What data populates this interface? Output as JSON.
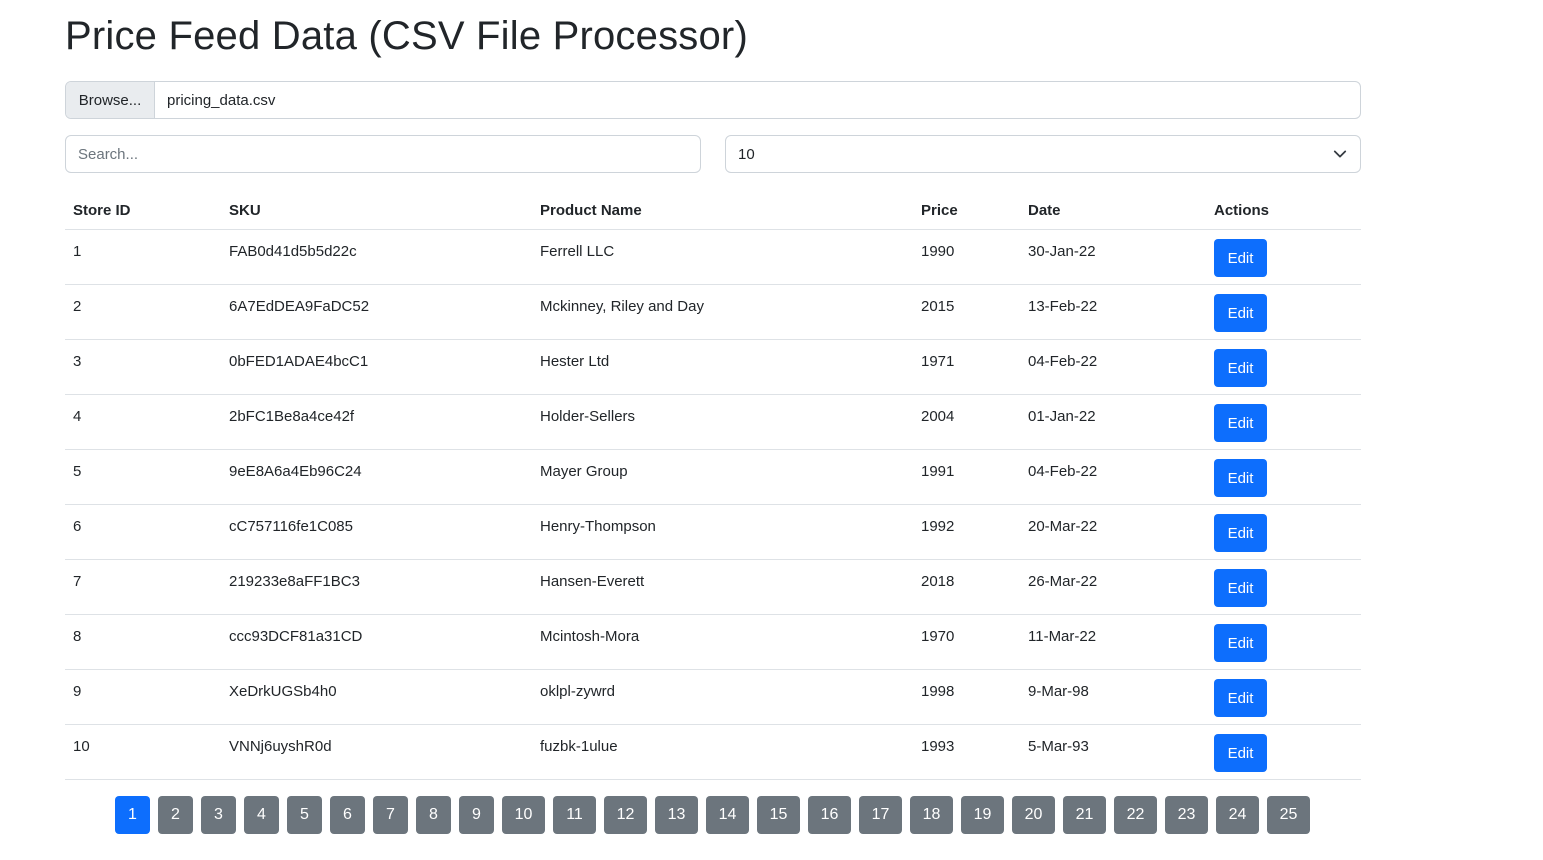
{
  "page_title": "Price Feed Data (CSV File Processor)",
  "file_input": {
    "button_label": "Browse...",
    "file_name": "pricing_data.csv"
  },
  "search": {
    "placeholder": "Search...",
    "value": ""
  },
  "page_size": {
    "selected": "10"
  },
  "table": {
    "headers": [
      "Store ID",
      "SKU",
      "Product Name",
      "Price",
      "Date",
      "Actions"
    ],
    "action_label": "Edit",
    "rows": [
      [
        "1",
        "FAB0d41d5b5d22c",
        "Ferrell LLC",
        "1990",
        "30-Jan-22"
      ],
      [
        "2",
        "6A7EdDEA9FaDC52",
        "Mckinney, Riley and Day",
        "2015",
        "13-Feb-22"
      ],
      [
        "3",
        "0bFED1ADAE4bcC1",
        "Hester Ltd",
        "1971",
        "04-Feb-22"
      ],
      [
        "4",
        "2bFC1Be8a4ce42f",
        "Holder-Sellers",
        "2004",
        "01-Jan-22"
      ],
      [
        "5",
        "9eE8A6a4Eb96C24",
        "Mayer Group",
        "1991",
        "04-Feb-22"
      ],
      [
        "6",
        "cC757116fe1C085",
        "Henry-Thompson",
        "1992",
        "20-Mar-22"
      ],
      [
        "7",
        "219233e8aFF1BC3",
        "Hansen-Everett",
        "2018",
        "26-Mar-22"
      ],
      [
        "8",
        "ccc93DCF81a31CD",
        "Mcintosh-Mora",
        "1970",
        "11-Mar-22"
      ],
      [
        "9",
        "XeDrkUGSb4h0",
        "oklpl-zywrd",
        "1998",
        "9-Mar-98"
      ],
      [
        "10",
        "VNNj6uyshR0d",
        "fuzbk-1ulue",
        "1993",
        "5-Mar-93"
      ]
    ]
  },
  "pagination": {
    "pages": [
      "1",
      "2",
      "3",
      "4",
      "5",
      "6",
      "7",
      "8",
      "9",
      "10",
      "11",
      "12",
      "13",
      "14",
      "15",
      "16",
      "17",
      "18",
      "19",
      "20",
      "21",
      "22",
      "23",
      "24",
      "25"
    ],
    "active": "1"
  },
  "colors": {
    "primary": "#0d6efd",
    "secondary": "#6c757d"
  }
}
